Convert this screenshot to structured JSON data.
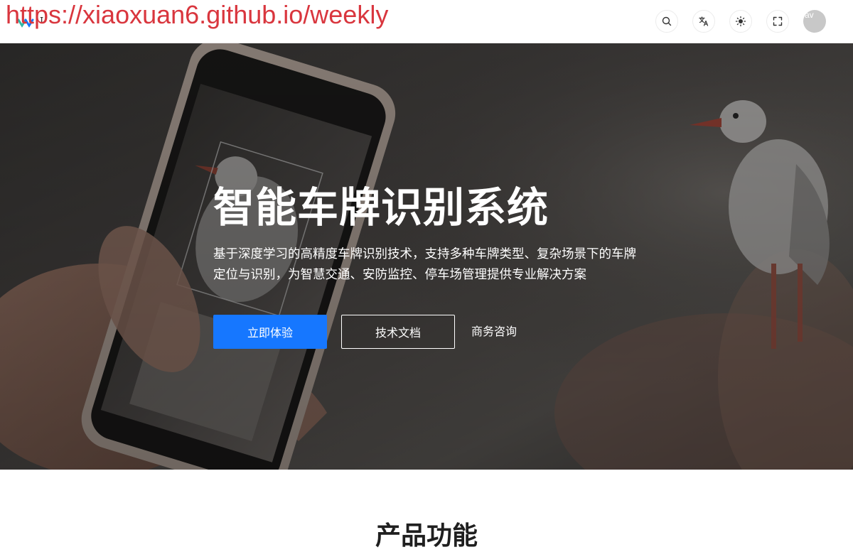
{
  "watermark": {
    "url": "https://xiaoxuan6.github.io/weekly"
  },
  "header": {
    "site_name": "ɪ",
    "tools": [
      {
        "name": "search",
        "icon": "search-icon"
      },
      {
        "name": "language",
        "icon": "translate-icon"
      },
      {
        "name": "theme",
        "icon": "sun-icon"
      },
      {
        "name": "fullscreen",
        "icon": "fullscreen-icon"
      }
    ],
    "avatar_alt": "av"
  },
  "hero": {
    "title": "智能车牌识别系统",
    "description": "基于深度学习的高精度车牌识别技术，支持多种车牌类型、复杂场景下的车牌定位与识别，为智慧交通、安防监控、停车场管理提供专业解决方案",
    "primary_button": "立即体验",
    "secondary_button": "技术文档",
    "link_button": "商务咨询"
  },
  "next_section": {
    "title": "产品功能"
  },
  "colors": {
    "primary": "#1677ff",
    "watermark": "#d9363e",
    "header_bg": "#ffffff"
  }
}
